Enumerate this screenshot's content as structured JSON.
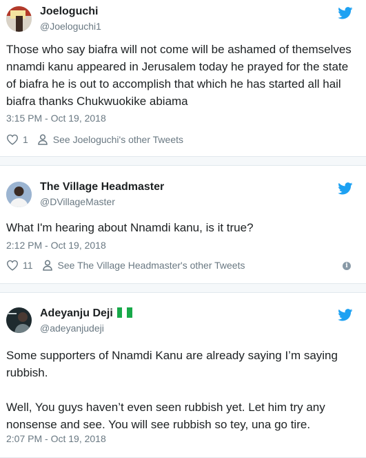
{
  "colors": {
    "twitter_blue": "#1da1f2",
    "meta_gray": "#697882",
    "text": "#1c2022",
    "flag_green": "#18a94a"
  },
  "tweets": [
    {
      "name": "Joeloguchi",
      "handle": "@Joeloguchi1",
      "text": "Those who say biafra will not come will be ashamed of themselves nnamdi kanu appeared in Jerusalem today he prayed for the state of biafra he is out to accomplish that which he has started all hail biafra thanks Chukwuokike abiama",
      "time": "3:15 PM - Oct 19, 2018",
      "likes": "1",
      "other_tweets": "See Joeloguchi's other Tweets"
    },
    {
      "name": "The Village Headmaster",
      "handle": "@DVillageMaster",
      "text": "What I'm hearing about Nnamdi kanu, is it true?",
      "time": "2:12 PM - Oct 19, 2018",
      "likes": "11",
      "other_tweets": "See The Village Headmaster's other Tweets"
    },
    {
      "name": "Adeyanju Deji",
      "handle": "@adeyanjudeji",
      "text": "Some supporters of Nnamdi Kanu are already saying I’m saying rubbish.\n\nWell, You guys haven’t even seen rubbish yet. Let him try any nonsense and see. You will see rubbish so tey, una go tire.",
      "time": "2:07 PM - Oct 19, 2018"
    }
  ],
  "icons": {
    "twitter": "twitter-bird-icon",
    "like": "heart-icon",
    "profile": "person-icon",
    "info": "info-icon",
    "flag": "nigeria-flag-icon"
  }
}
